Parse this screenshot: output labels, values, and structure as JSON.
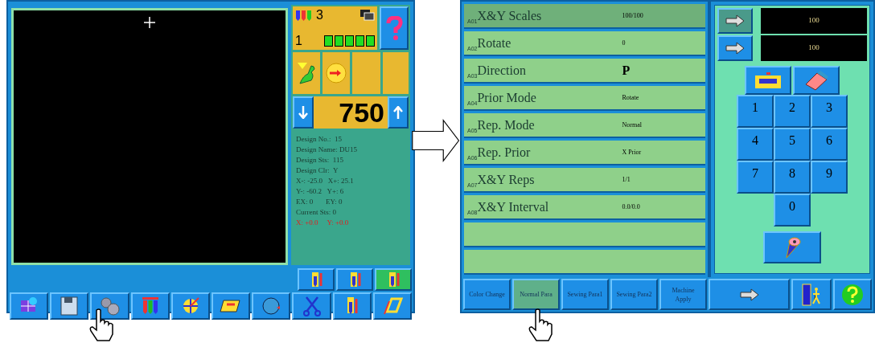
{
  "left_screen": {
    "status": {
      "color_count": "3",
      "head": "1",
      "needles": [
        {
          "on": true
        },
        {
          "on": true
        },
        {
          "on": true
        },
        {
          "on": true
        },
        {
          "on": true
        }
      ]
    },
    "counter": "750",
    "info": [
      {
        "kind": "normal",
        "text": "Design No.:  15"
      },
      {
        "kind": "normal",
        "text": "Design Name: DU15"
      },
      {
        "kind": "normal",
        "text": "Design Sts:  115"
      },
      {
        "kind": "normal",
        "text": "Design Clr:  Y"
      },
      {
        "kind": "normal",
        "text": "X-: -25.0   X+: 25.1"
      },
      {
        "kind": "normal",
        "text": "Y-: -60.2   Y+: 6"
      },
      {
        "kind": "normal",
        "text": "EX: 0       EY: 0"
      },
      {
        "kind": "normal",
        "text": "Current Sts: 0"
      },
      {
        "kind": "alert",
        "text": "X: +0.0     Y: +0.0"
      }
    ]
  },
  "right_screen": {
    "params": [
      {
        "code": "A01",
        "label": "X&Y Scales",
        "value": "100/100",
        "selected": true
      },
      {
        "code": "A02",
        "label": "Rotate",
        "value": "0",
        "selected": false
      },
      {
        "code": "A03",
        "label": "Direction",
        "value": "P",
        "selected": false
      },
      {
        "code": "A04",
        "label": "Prior Mode",
        "value": "Rotate",
        "selected": false
      },
      {
        "code": "A05",
        "label": "Rep. Mode",
        "value": "Normal",
        "selected": false
      },
      {
        "code": "A06",
        "label": "Rep. Prior",
        "value": "X Prior",
        "selected": false
      },
      {
        "code": "A07",
        "label": "X&Y Reps",
        "value": "1/1",
        "selected": false
      },
      {
        "code": "A08",
        "label": "X&Y Interval",
        "value": "0.0/0.0",
        "selected": false
      }
    ],
    "inputs": [
      {
        "value": "100",
        "selected": true
      },
      {
        "value": "100",
        "selected": false
      }
    ],
    "keys": [
      "1",
      "2",
      "3",
      "4",
      "5",
      "6",
      "7",
      "8",
      "9",
      "0"
    ],
    "tabs": [
      {
        "label": "Color Change",
        "selected": false
      },
      {
        "label": "Normal Para",
        "selected": true
      },
      {
        "label": "Sewing Para1",
        "selected": false
      },
      {
        "label": "Sewing Para2",
        "selected": false
      },
      {
        "label": "Machine Apply",
        "selected": false
      }
    ]
  }
}
